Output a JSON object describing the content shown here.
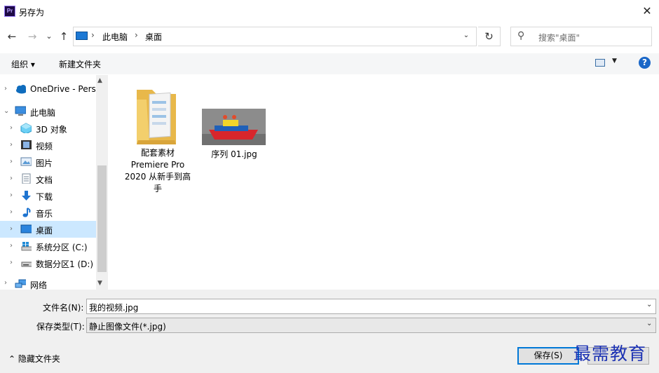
{
  "window": {
    "title": "另存为",
    "app_icon_text": "Pr",
    "close_glyph": "✕"
  },
  "nav": {
    "back": "←",
    "forward": "→",
    "recent": "⌄",
    "up": "↑"
  },
  "address": {
    "crumbs": [
      "此电脑",
      "桌面"
    ],
    "sep": "›",
    "dropdown": "⌄",
    "refresh": "↻"
  },
  "search": {
    "placeholder": "搜索\"桌面\"",
    "icon": "⚲"
  },
  "toolbar": {
    "organize": "组织 ▾",
    "new_folder": "新建文件夹",
    "view_dd": "▼",
    "help": "?"
  },
  "tree": [
    {
      "label": "OneDrive - Perso",
      "icon": "cloud-icon",
      "arrow": "›"
    },
    {
      "label": "此电脑",
      "icon": "computer-icon",
      "arrow": "⌄"
    },
    {
      "label": "3D 对象",
      "icon": "cube-icon",
      "arrow": "›"
    },
    {
      "label": "视频",
      "icon": "film-icon",
      "arrow": "›"
    },
    {
      "label": "图片",
      "icon": "picture-icon",
      "arrow": "›"
    },
    {
      "label": "文档",
      "icon": "document-icon",
      "arrow": "›"
    },
    {
      "label": "下载",
      "icon": "download-icon",
      "arrow": "›"
    },
    {
      "label": "音乐",
      "icon": "music-icon",
      "arrow": "›"
    },
    {
      "label": "桌面",
      "icon": "desktop-icon",
      "arrow": "›",
      "selected": true
    },
    {
      "label": "系统分区 (C:)",
      "icon": "windows-drive-icon",
      "arrow": "›"
    },
    {
      "label": "数据分区1 (D:)",
      "icon": "drive-icon",
      "arrow": "›"
    },
    {
      "label": "网络",
      "icon": "network-icon",
      "arrow": "›"
    }
  ],
  "scroll": {
    "up": "▲",
    "down": "▼"
  },
  "files": [
    {
      "lines": [
        "配套素材",
        "Premiere Pro",
        "2020 从新手到高",
        "手"
      ],
      "type": "folder"
    },
    {
      "lines": [
        "序列 01.jpg"
      ],
      "type": "image"
    }
  ],
  "form": {
    "filename_label": "文件名(N):",
    "filename_value": "我的视频.jpg",
    "filetype_label": "保存类型(T):",
    "filetype_value": "静止图像文件(*.jpg)",
    "combo_arrow": "⌄"
  },
  "footer": {
    "hide_folders": "⌃  隐藏文件夹",
    "save": "保存(S)",
    "watermark": "最需教育"
  },
  "colors": {
    "accent": "#0078d7",
    "selected": "#cce8ff",
    "watermark": "#1b31b3"
  }
}
